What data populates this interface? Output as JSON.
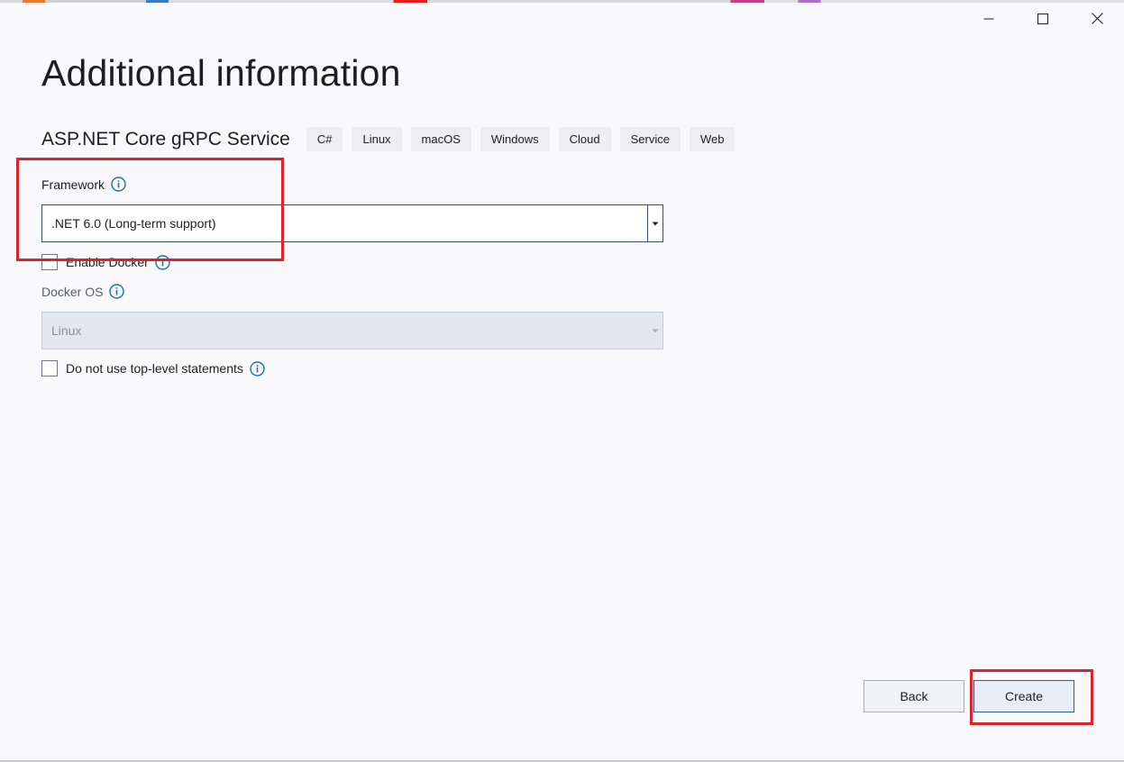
{
  "window": {
    "controls": [
      {
        "name": "minimize",
        "icon": "minimize-icon"
      },
      {
        "name": "maximize",
        "icon": "maximize-icon"
      },
      {
        "name": "close",
        "icon": "close-icon"
      }
    ]
  },
  "page": {
    "title": "Additional information"
  },
  "template": {
    "name": "ASP.NET Core gRPC Service",
    "tags": [
      "C#",
      "Linux",
      "macOS",
      "Windows",
      "Cloud",
      "Service",
      "Web"
    ]
  },
  "framework": {
    "label": "Framework",
    "selected": ".NET 6.0 (Long-term support)",
    "info_icon": "info-icon"
  },
  "docker": {
    "enable_label": "Enable Docker",
    "enable_checked": false,
    "os_label": "Docker OS",
    "os_selected": "Linux",
    "os_disabled": true
  },
  "top_level": {
    "label": "Do not use top-level statements",
    "checked": false
  },
  "buttons": {
    "back": "Back",
    "create": "Create"
  },
  "colors": {
    "accent_info": "#1b6fb3",
    "highlight": "#d8242c",
    "primary_border": "#2e5f9c"
  }
}
